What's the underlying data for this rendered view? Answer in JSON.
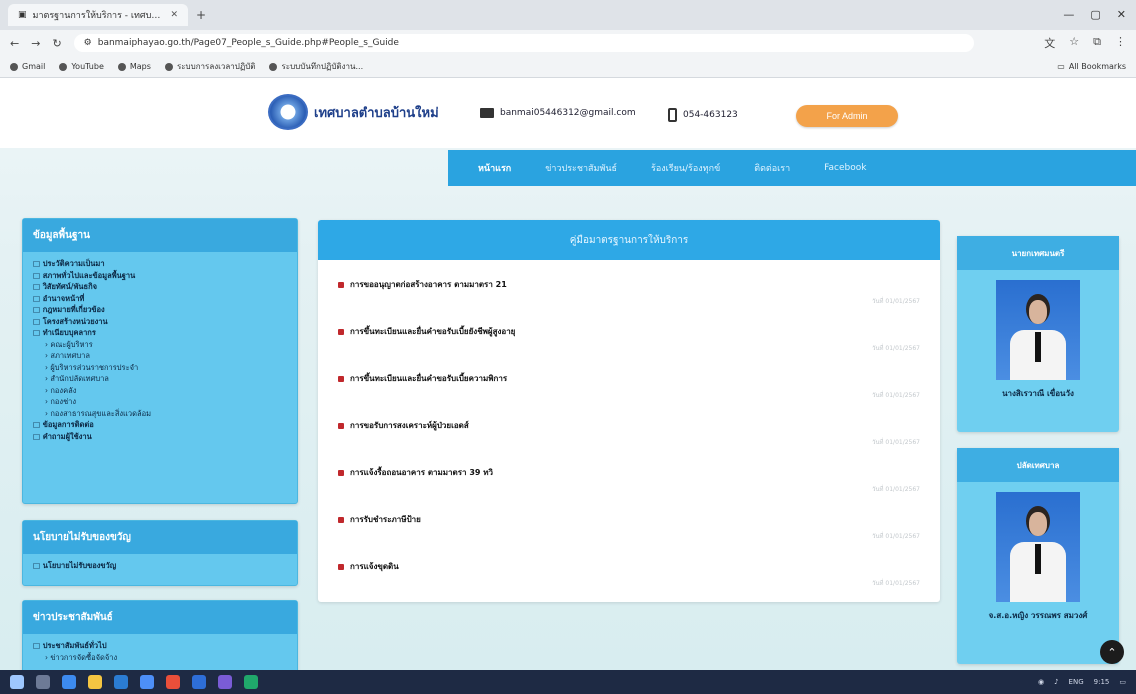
{
  "browser": {
    "tab_title": "มาตรฐานการให้บริการ - เทศบาลตำบลบ้านใหม่",
    "url": "banmaiphayao.go.th/Page07_People_s_Guide.php#People_s_Guide",
    "bookmarks": [
      "Gmail",
      "YouTube",
      "Maps",
      "ระบบการลงเวลาปฏิบัติ",
      "ระบบบันทึกปฏิบัติงาน..."
    ],
    "all_bookmarks": "All Bookmarks"
  },
  "site": {
    "name": "เทศบาลตำบลบ้านใหม่",
    "email": "banmai05446312@gmail.com",
    "phone": "054-463123",
    "admin_label": "For Admin"
  },
  "nav": {
    "items": [
      "หน้าแรก",
      "ข่าวประชาสัมพันธ์",
      "ร้องเรียน/ร้องทุกข์",
      "ติดต่อเรา",
      "Facebook"
    ]
  },
  "sidebar": {
    "basic": {
      "title": "ข้อมูลพื้นฐาน",
      "items": [
        {
          "label": "ประวัติความเป็นมา",
          "type": "top"
        },
        {
          "label": "สภาพทั่วไปและข้อมูลพื้นฐาน",
          "type": "top"
        },
        {
          "label": "วิสัยทัศน์/พันธกิจ",
          "type": "top"
        },
        {
          "label": "อำนาจหน้าที่",
          "type": "top"
        },
        {
          "label": "กฎหมายที่เกี่ยวข้อง",
          "type": "top"
        },
        {
          "label": "โครงสร้างหน่วยงาน",
          "type": "top"
        },
        {
          "label": "ทำเนียบบุคลากร",
          "type": "grp"
        },
        {
          "label": "คณะผู้บริหาร",
          "type": "sub"
        },
        {
          "label": "สภาเทศบาล",
          "type": "sub"
        },
        {
          "label": "ผู้บริหารส่วนราชการประจำ",
          "type": "sub"
        },
        {
          "label": "สำนักปลัดเทศบาล",
          "type": "sub"
        },
        {
          "label": "กองคลัง",
          "type": "sub"
        },
        {
          "label": "กองช่าง",
          "type": "sub"
        },
        {
          "label": "กองสาธารณสุขและสิ่งแวดล้อม",
          "type": "sub"
        },
        {
          "label": "ข้อมูลการติดต่อ",
          "type": "top"
        },
        {
          "label": "คำถามผู้ใช้งาน",
          "type": "top"
        }
      ]
    },
    "policy": {
      "title": "นโยบายไม่รับของขวัญ",
      "items": [
        {
          "label": "นโยบายไม่รับของขวัญ",
          "type": "top"
        }
      ]
    },
    "news": {
      "title": "ข่าวประชาสัมพันธ์",
      "items": [
        {
          "label": "ประชาสัมพันธ์ทั่วไป",
          "type": "top"
        },
        {
          "label": "ข่าวการจัดซื้อจัดจ้าง",
          "type": "sub"
        }
      ]
    }
  },
  "main": {
    "title": "คู่มือมาตรฐานการให้บริการ",
    "items": [
      {
        "label": "การขออนุญาตก่อสร้างอาคาร ตามมาตรา 21",
        "date": "วันที่ 01/01/2567"
      },
      {
        "label": "การขึ้นทะเบียนและยื่นคำขอรับเบี้ยยังชีพผู้สูงอายุ",
        "date": "วันที่ 01/01/2567"
      },
      {
        "label": "การขึ้นทะเบียนและยื่นคำขอรับเบี้ยความพิการ",
        "date": "วันที่ 01/01/2567"
      },
      {
        "label": "การขอรับการสงเคราะห์ผู้ป่วยเอดส์",
        "date": "วันที่ 01/01/2567"
      },
      {
        "label": "การแจ้งรื้อถอนอาคาร ตามมาตรา 39 ทวิ",
        "date": "วันที่ 01/01/2567"
      },
      {
        "label": "การรับชำระภาษีป้าย",
        "date": "วันที่ 01/01/2567"
      },
      {
        "label": "การแจ้งขุดดิน",
        "date": "วันที่ 01/01/2567"
      }
    ]
  },
  "people": [
    {
      "role": "นายกเทศมนตรี",
      "name": "นางสิเรวาณี เขื่อนวัง"
    },
    {
      "role": "ปลัดเทศบาล",
      "name": "จ.ส.อ.หญิง วรรณพร สมวงศ์"
    }
  ],
  "taskbar": {
    "time": "9:15",
    "lang": "ENG"
  }
}
